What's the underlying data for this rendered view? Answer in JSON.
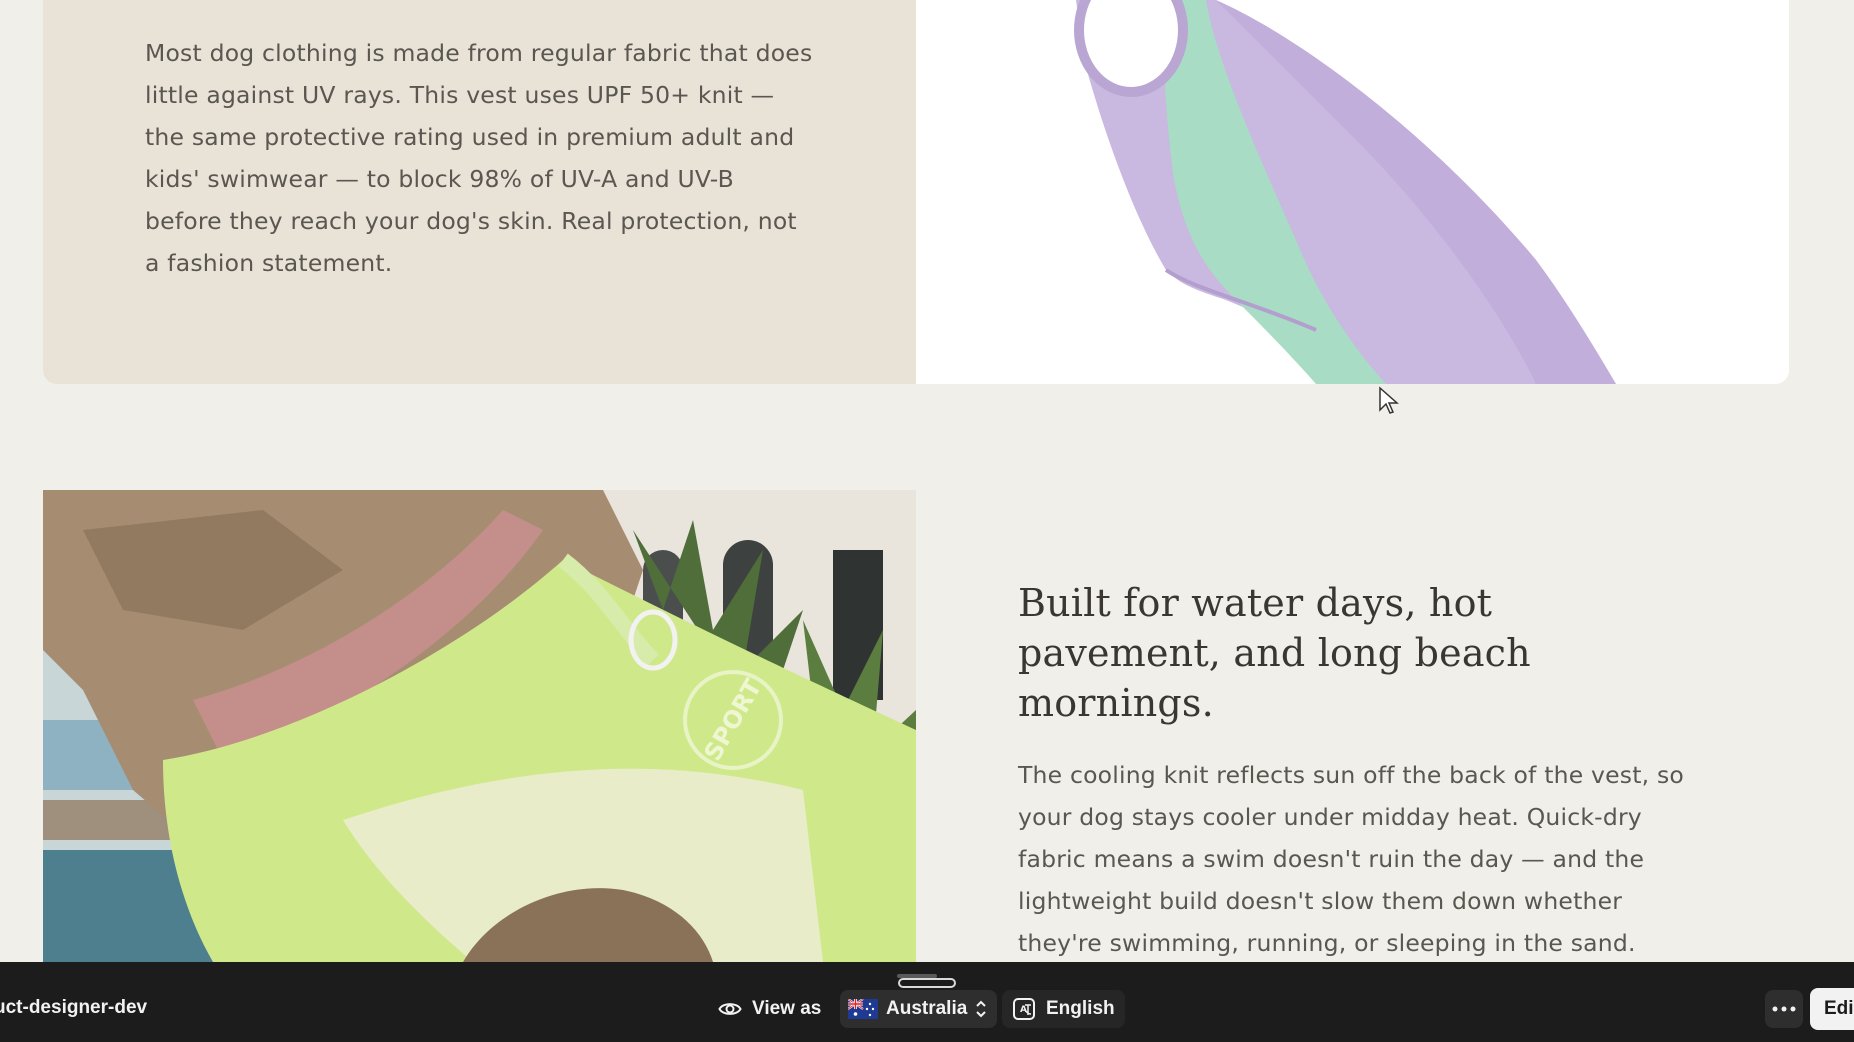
{
  "section_uv": {
    "body": "Most dog clothing is made from regular fabric that does little against UV rays. This vest uses UPF 50+ knit — the same protective rating used in premium adult and kids' swimwear — to block 98% of UV-A and UV-B before they reach your dog's skin. Real protection, not a fashion statement.",
    "image_icon": "lavender-mint-dog-vest-photo"
  },
  "section_water": {
    "heading": "Built for water days, hot pavement, and long beach mornings.",
    "body": "The cooling knit reflects sun off the back of the vest, so your dog stays cooler under midday heat. Quick-dry fabric means a swim doesn't ruin the day — and the lightweight build doesn't slow them down whether they're swimming, running, or sleeping in the sand.",
    "image_icon": "dog-wearing-green-sport-vest-by-pool-photo",
    "vest_print": "SPORT"
  },
  "toolbar": {
    "store_name": "uct-designer-dev",
    "view_as_label": "View as",
    "view_as_icon": "eye-icon",
    "country_label": "Australia",
    "country_icon": "australia-flag-icon",
    "language_label": "English",
    "language_icon": "translate-icon",
    "more_icon": "ellipsis-icon",
    "edit_label": "Edi"
  },
  "colors": {
    "page_bg": "#f1efe9",
    "text_panel_bg": "#e8e2d7",
    "toolbar_bg": "#1c1c1c",
    "vest_lavender": "#c7b6de",
    "vest_mint": "#a9dcc6",
    "vest_green": "#cfe88a"
  }
}
